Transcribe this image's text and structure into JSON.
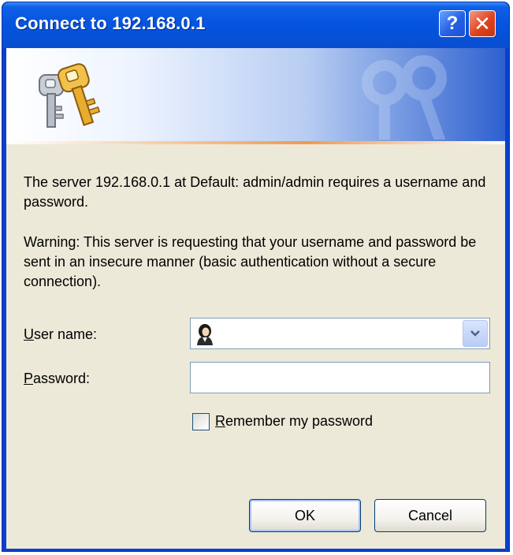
{
  "window": {
    "title": "Connect to 192.168.0.1",
    "help_button": "?",
    "close_button": "✕"
  },
  "message": {
    "line1": "The server 192.168.0.1 at Default: admin/admin requires a username and password.",
    "warning": "Warning: This server is requesting that your username and password be sent in an insecure manner (basic authentication without a secure connection)."
  },
  "form": {
    "username_label_mnemonic": "U",
    "username_label_rest": "ser name:",
    "username_value": "",
    "password_label_mnemonic": "P",
    "password_label_rest": "assword:",
    "password_value": "",
    "remember_mnemonic": "R",
    "remember_rest": "emember my password",
    "remember_checked": false
  },
  "buttons": {
    "ok": "OK",
    "cancel": "Cancel"
  },
  "icons": {
    "banner": "keys-icon",
    "username": "user-icon",
    "dropdown": "chevron-down-icon"
  },
  "colors": {
    "titlebar": "#0655e0",
    "dialog_bg": "#ece9d8",
    "input_border": "#7f9db9",
    "banner_accent": "#f09a4a"
  }
}
